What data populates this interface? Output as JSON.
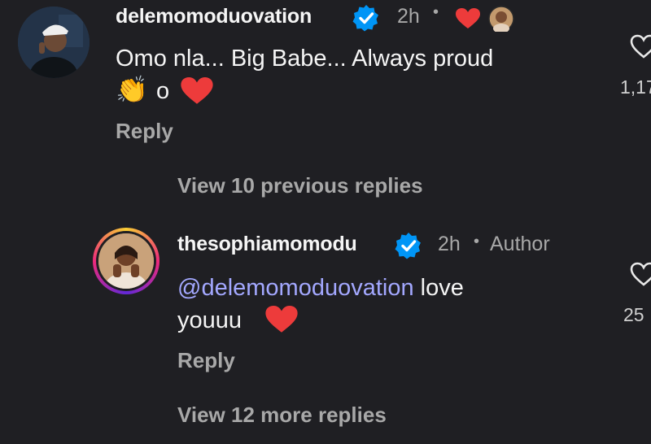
{
  "comment": {
    "username": "delemomoduovation",
    "time": "2h",
    "separator": "•",
    "text_line1": "Omo nla... Big Babe... Always proud",
    "text_line2": "o",
    "emoji_clap": "👏",
    "emoji_heart": "❤",
    "reply_label": "Reply",
    "like_count": "1,17",
    "icons": [
      "verified-badge-icon",
      "red-heart-icon",
      "author-liked-avatar-icon",
      "heart-outline-icon"
    ]
  },
  "view_previous": "View 10 previous replies",
  "reply": {
    "username": "thesophiamomodu",
    "time": "2h",
    "separator": "•",
    "author_label": "Author",
    "mention": "@delemomoduovation",
    "text_after_mention": " love",
    "text_line2": "youuu",
    "emoji_heart": "❤",
    "reply_label": "Reply",
    "like_count": "25",
    "icons": [
      "verified-badge-icon",
      "heart-outline-icon"
    ]
  },
  "view_more": "View 12 more replies",
  "colors": {
    "background": "#1f1f23",
    "verified": "#0095f6",
    "heart": "#ed3b3b",
    "mention": "#a3a8ff",
    "muted": "#a8a8a8"
  }
}
